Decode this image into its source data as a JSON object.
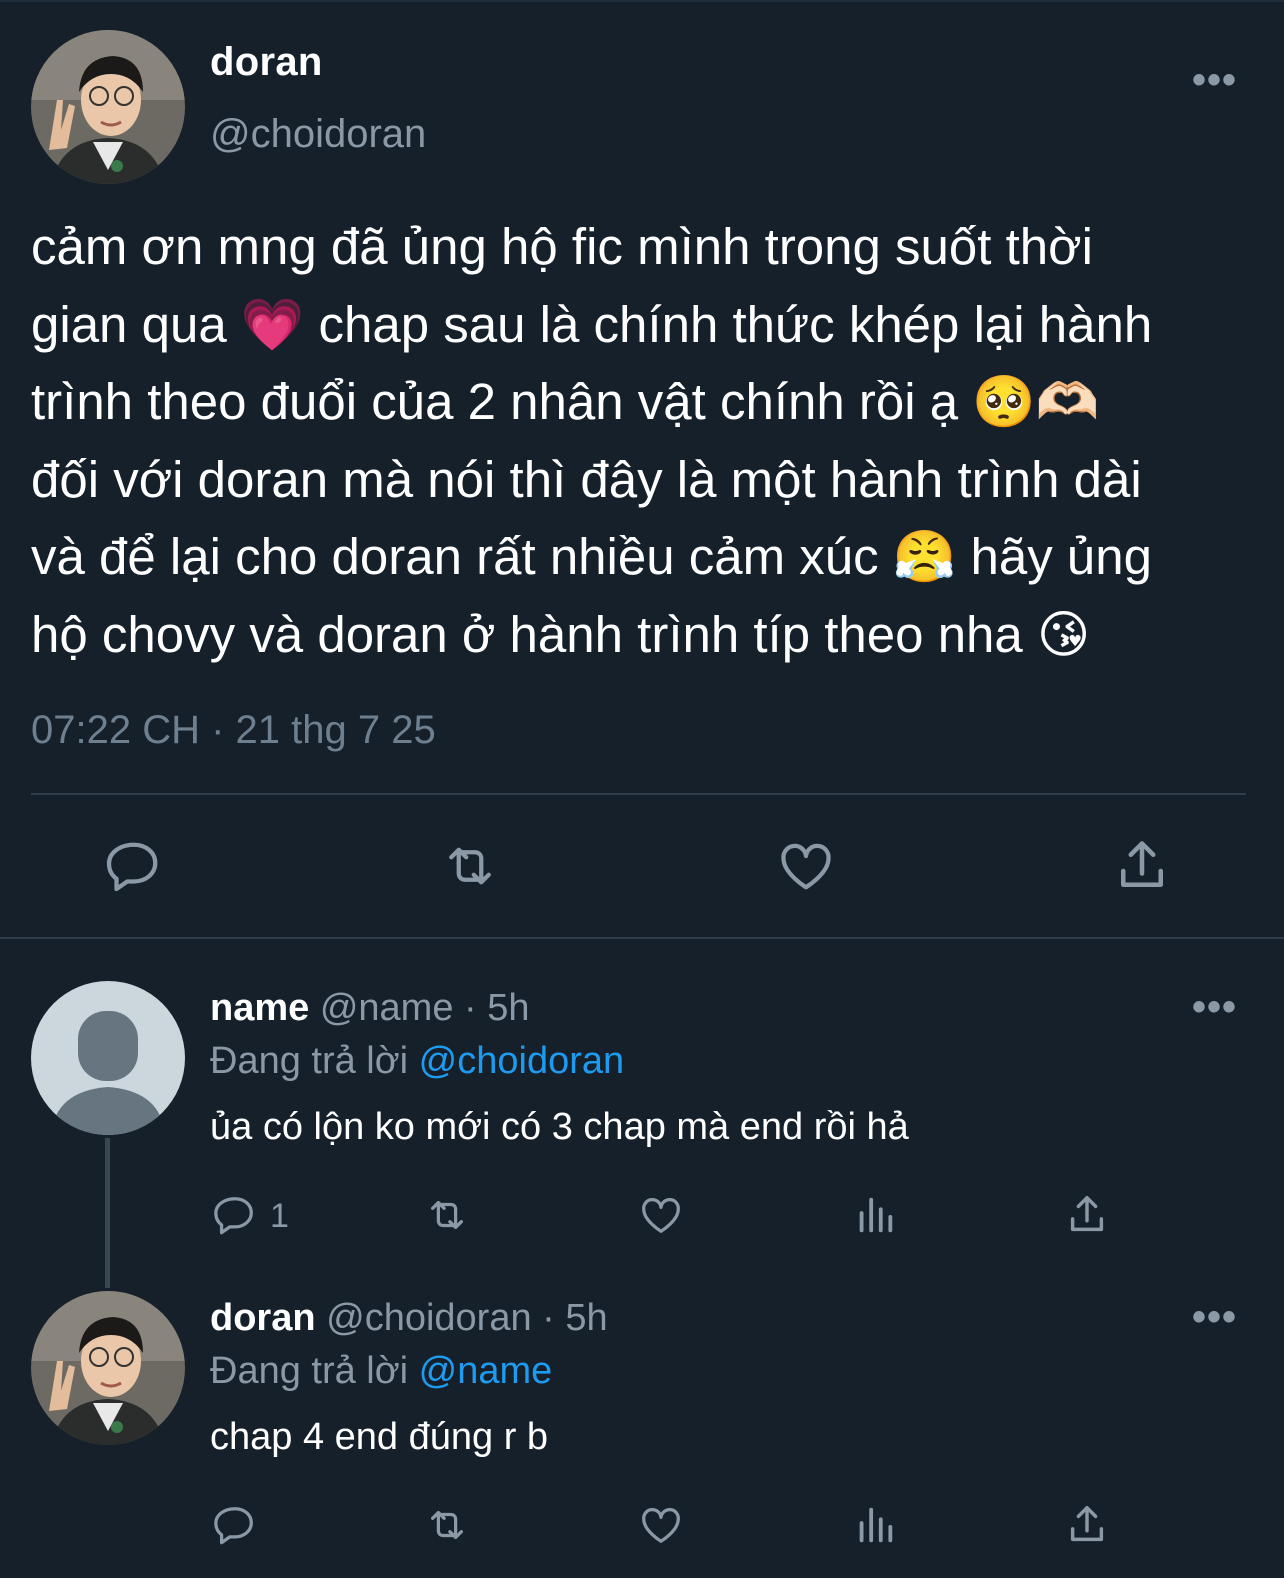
{
  "main_tweet": {
    "author_name": "doran",
    "author_handle": "@choidoran",
    "text": "cảm ơn mng đã ủng hộ fic mình trong suốt thời\ngian qua 💗  chap sau là chính thức khép lại hành\ntrình theo đuổi của 2 nhân vật chính rồi ạ 🥺🫶🏻\nđối với doran mà nói thì đây là một hành trình dài\nvà để lại cho doran rất nhiều cảm xúc 😤  hãy ủng\nhộ chovy và doran ở hành trình típ theo nha 😘",
    "timestamp": "07:22 CH · 21 thg 7 25",
    "actions": [
      "reply-icon",
      "retweet-icon",
      "like-icon",
      "share-icon"
    ]
  },
  "more_glyph": "•••",
  "replies": [
    {
      "name": "name",
      "handle": "@name",
      "sep": "·",
      "time": "5h",
      "replying_label": "Đang trả lời",
      "replying_to": "@choidoran",
      "text": "ủa có lộn ko mới có 3 chap mà end rồi hả",
      "reply_count": "1"
    },
    {
      "name": "doran",
      "handle": "@choidoran",
      "sep": "·",
      "time": "5h",
      "replying_label": "Đang trả lời",
      "replying_to": "@name",
      "text": "chap 4 end đúng r b",
      "reply_count": ""
    }
  ],
  "colors": {
    "background": "#15202b",
    "secondary_text": "#8b98a5",
    "mention": "#1d9bf0",
    "divider": "#2f3d4a"
  }
}
